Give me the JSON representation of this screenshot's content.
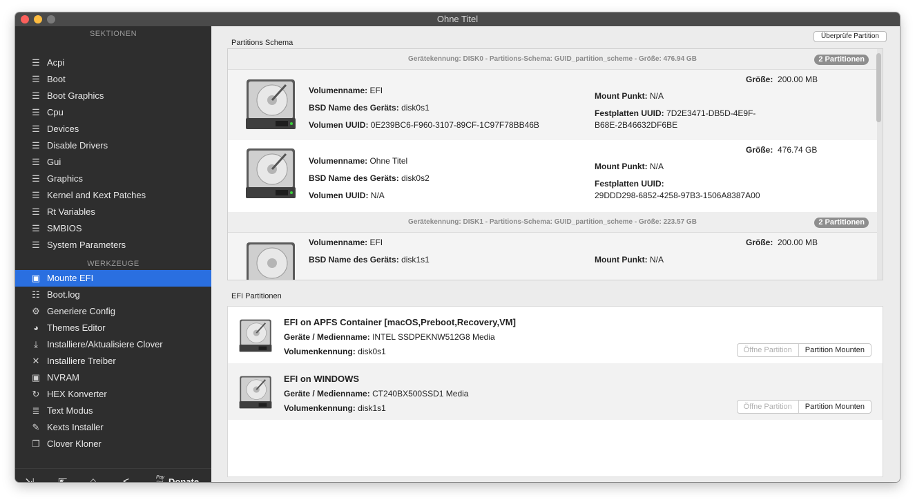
{
  "window": {
    "title": "Ohne Titel",
    "traffic": {
      "close": "#fc605c",
      "minimize": "#fdbc40",
      "zoom": "#8a8a8a"
    }
  },
  "sidebar": {
    "sections_header": "SEKTIONEN",
    "sections": [
      {
        "label": "Acpi",
        "icon": "list-icon"
      },
      {
        "label": "Boot",
        "icon": "list-icon"
      },
      {
        "label": "Boot Graphics",
        "icon": "list-icon"
      },
      {
        "label": "Cpu",
        "icon": "list-icon"
      },
      {
        "label": "Devices",
        "icon": "list-icon"
      },
      {
        "label": "Disable Drivers",
        "icon": "list-icon"
      },
      {
        "label": "Gui",
        "icon": "list-icon"
      },
      {
        "label": "Graphics",
        "icon": "list-icon"
      },
      {
        "label": "Kernel and Kext Patches",
        "icon": "list-icon"
      },
      {
        "label": "Rt Variables",
        "icon": "list-icon"
      },
      {
        "label": "SMBIOS",
        "icon": "list-icon"
      },
      {
        "label": "System Parameters",
        "icon": "list-icon"
      }
    ],
    "tools_header": "WERKZEUGE",
    "tools": [
      {
        "label": "Mounte EFI",
        "icon": "disk-icon",
        "active": true
      },
      {
        "label": "Boot.log",
        "icon": "log-icon"
      },
      {
        "label": "Generiere Config",
        "icon": "gears-icon"
      },
      {
        "label": "Themes Editor",
        "icon": "palette-icon"
      },
      {
        "label": "Installiere/Aktualisiere Clover",
        "icon": "install-icon"
      },
      {
        "label": "Installiere Treiber",
        "icon": "tools-icon"
      },
      {
        "label": "NVRAM",
        "icon": "chip-icon"
      },
      {
        "label": "HEX Konverter",
        "icon": "convert-icon"
      },
      {
        "label": "Text Modus",
        "icon": "text-icon"
      },
      {
        "label": "Kexts Installer",
        "icon": "kext-icon"
      },
      {
        "label": "Clover Kloner",
        "icon": "clone-icon"
      }
    ],
    "bottom": {
      "paypal": "Pay Pal",
      "donate": "Donate"
    }
  },
  "main": {
    "partitions_label": "Partitions Schema",
    "check_button": "Überprüfe Partition",
    "disks": [
      {
        "header": "Gerätekennung: DISK0 - Partitions-Schema: GUID_partition_scheme - Größe: 476.94 GB",
        "badge": "2 Partitionen"
      },
      {
        "header": "Gerätekennung: DISK1 - Partitions-Schema: GUID_partition_scheme - Größe: 223.57 GB",
        "badge": "2 Partitionen"
      }
    ],
    "labels": {
      "volume_name": "Volumenname:",
      "bsd_name": "BSD Name des Geräts:",
      "volume_uuid": "Volumen UUID:",
      "size": "Größe:",
      "mount_point": "Mount Punkt:",
      "disk_uuid": "Festplatten UUID:"
    },
    "partitions": [
      {
        "volume_name": "EFI",
        "bsd_name": "disk0s1",
        "volume_uuid": "0E239BC6-F960-3107-89CF-1C97F78BB46B",
        "size": "200.00 MB",
        "mount_point": "N/A",
        "disk_uuid_1": "7D2E3471-DB5D-4E9F-",
        "disk_uuid_2": "B68E-2B46632DF6BE"
      },
      {
        "volume_name": "Ohne Titel",
        "bsd_name": "disk0s2",
        "volume_uuid": "N/A",
        "size": "476.74 GB",
        "mount_point": "N/A",
        "disk_uuid_1": "",
        "disk_uuid_2": "29DDD298-6852-4258-97B3-1506A8387A00"
      },
      {
        "volume_name": "EFI",
        "bsd_name": "disk1s1",
        "size": "200.00 MB",
        "mount_point": "N/A"
      }
    ],
    "efi_label": "EFI Partitionen",
    "efi_labels": {
      "media": "Geräte / Medienname:",
      "volume_id": "Volumenkennung:"
    },
    "efi": [
      {
        "title": "EFI on APFS Container [macOS,Preboot,Recovery,VM]",
        "media": "INTEL SSDPEKNW512G8 Media",
        "volume_id": "disk0s1",
        "open_button": "Öffne Partition",
        "mount_button": "Partition Mounten"
      },
      {
        "title": "EFI on WINDOWS",
        "media": "CT240BX500SSD1 Media",
        "volume_id": "disk1s1",
        "open_button": "Öffne Partition",
        "mount_button": "Partition Mounten"
      }
    ]
  }
}
